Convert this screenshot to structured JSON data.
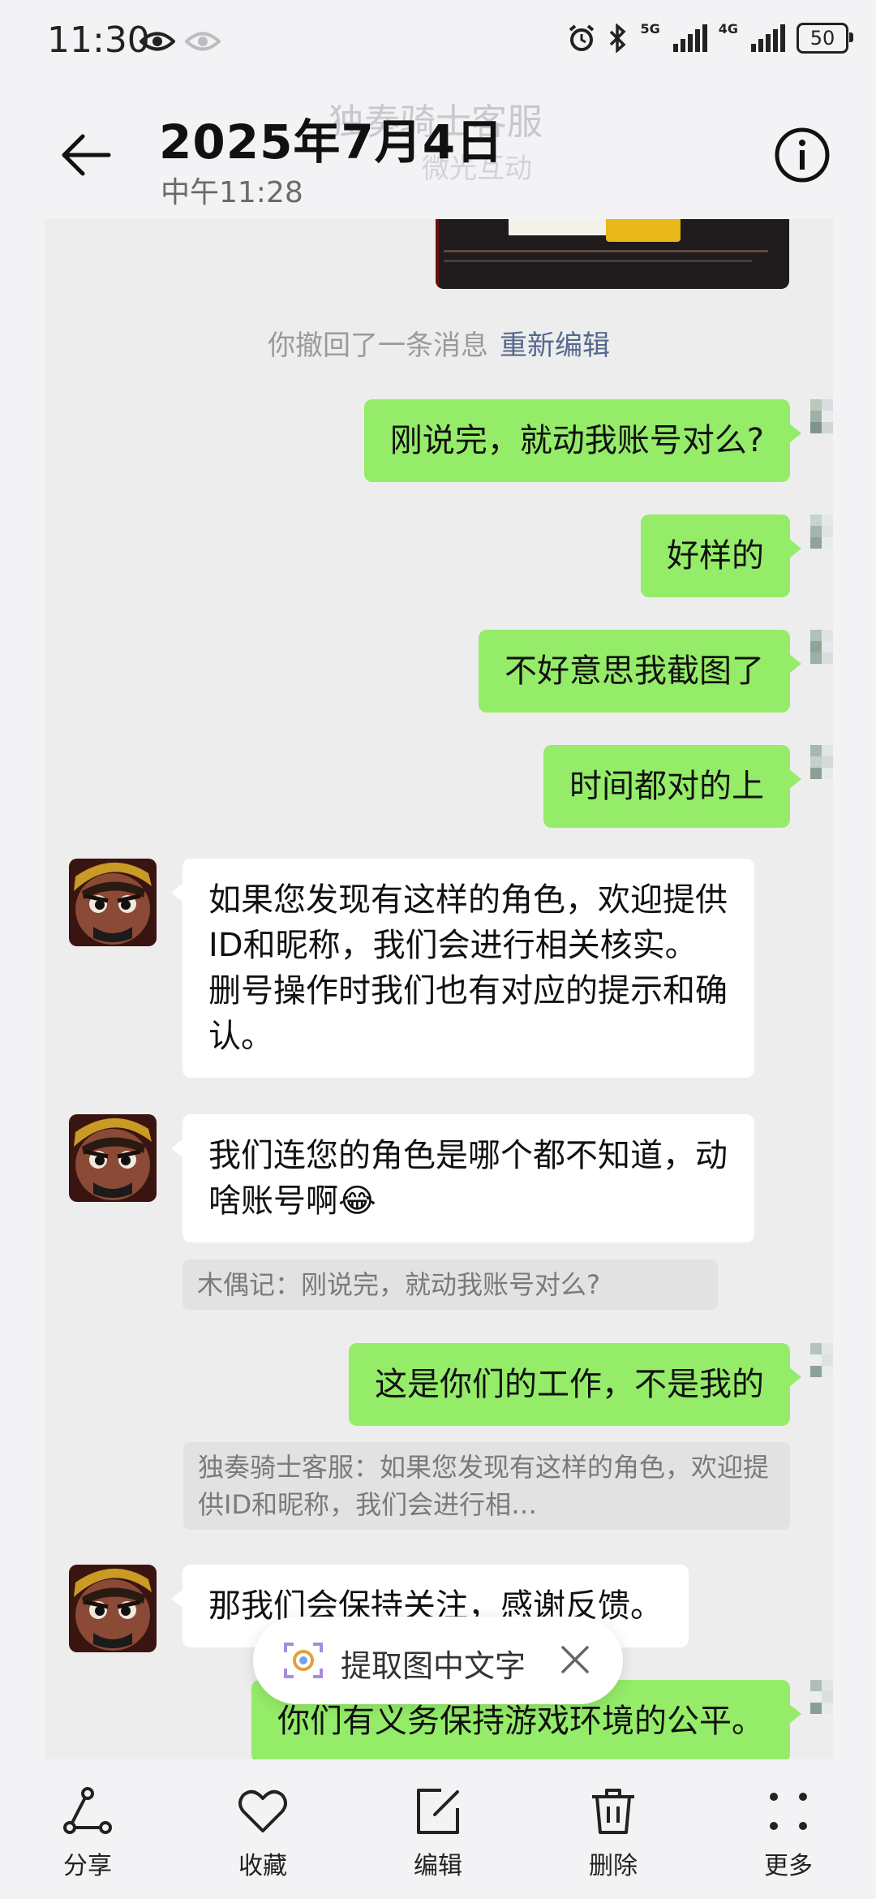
{
  "status_bar": {
    "time": "11:30",
    "network_5g": "5G",
    "network_4g": "4G",
    "battery": "50"
  },
  "header": {
    "title": "2025年7月4日",
    "subtitle": "中午11:28",
    "ghost_title": "独奏骑士客服",
    "ghost_subtitle": "微光互动"
  },
  "recall": {
    "text": "你撤回了一条消息",
    "link": "重新编辑"
  },
  "messages": [
    {
      "side": "me",
      "text": "刚说完，就动我账号对么?"
    },
    {
      "side": "me",
      "text": "好样的"
    },
    {
      "side": "me",
      "text": "不好意思我截图了"
    },
    {
      "side": "me",
      "text": "时间都对的上"
    },
    {
      "side": "them",
      "text": "如果您发现有这样的角色，欢迎提供ID和昵称，我们会进行相关核实。删号操作时我们也有对应的提示和确认。"
    },
    {
      "side": "them",
      "text": "我们连您的角色是哪个都不知道，动啥账号啊😂",
      "quote": "木偶记：刚说完，就动我账号对么?"
    },
    {
      "side": "me",
      "text": "这是你们的工作，不是我的",
      "quote": "独奏骑士客服：如果您发现有这样的角色，欢迎提供ID和昵称，我们会进行相…"
    },
    {
      "side": "them",
      "text": "那我们会保持关注，感谢反馈。"
    },
    {
      "side": "me",
      "text": "你们有义务保持游戏环境的公平。"
    }
  ],
  "ocr_pill": {
    "label": "提取图中文字"
  },
  "toolbar": {
    "share": "分享",
    "favorite": "收藏",
    "edit": "编辑",
    "delete": "删除",
    "more": "更多"
  },
  "colors": {
    "my_bubble": "#95ec69",
    "their_bubble": "#ffffff",
    "link": "#56688f",
    "chat_bg": "#ededed"
  }
}
